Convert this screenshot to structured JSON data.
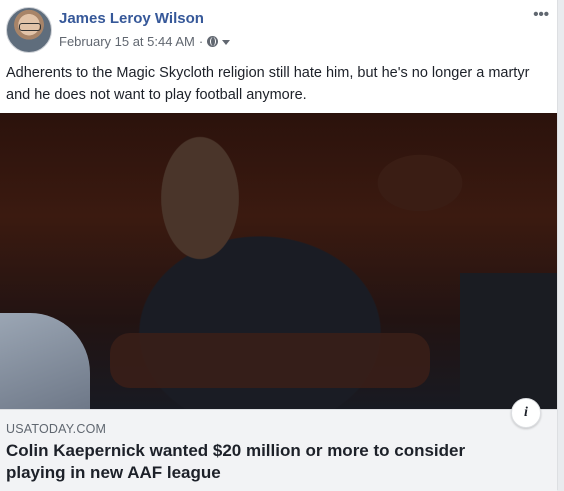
{
  "post": {
    "author": "James Leroy Wilson",
    "timestamp": "February 15 at 5:44 AM",
    "separator": "·",
    "privacy_icon": "globe-icon",
    "more_label": "•••",
    "text": "Adherents to the Magic Skycloth religion still hate him, but he's no longer a martyr and he does not want to play football anymore."
  },
  "link": {
    "image_alt": "Colin Kaepernick",
    "info_label": "i",
    "domain": "USATODAY.COM",
    "title": "Colin Kaepernick wanted $20 million or more to consider playing in new AAF league"
  },
  "colors": {
    "author_link": "#365899",
    "meta_text": "#616770",
    "preview_bg": "#f2f3f5"
  }
}
